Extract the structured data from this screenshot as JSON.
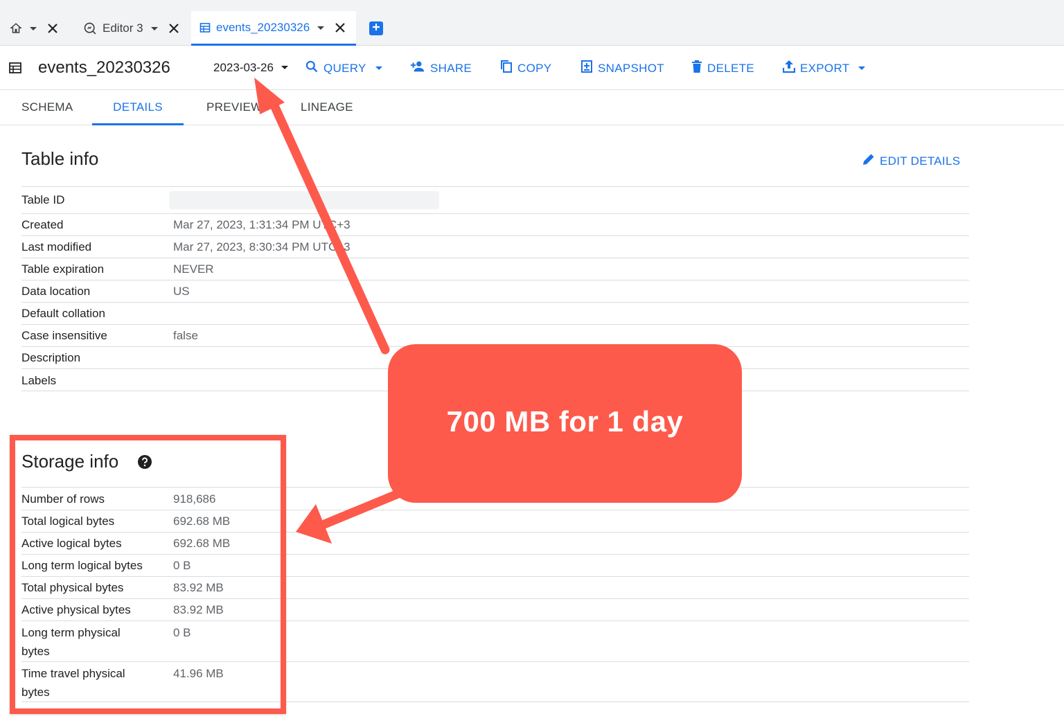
{
  "tabs": {
    "editor_label": "Editor 3",
    "active_label": "events_20230326"
  },
  "toolbar": {
    "title": "events_20230326",
    "date": "2023-03-26",
    "query": "QUERY",
    "share": "SHARE",
    "copy": "COPY",
    "snapshot": "SNAPSHOT",
    "delete": "DELETE",
    "export": "EXPORT"
  },
  "subtabs": {
    "schema": "SCHEMA",
    "details": "DETAILS",
    "preview": "PREVIEW",
    "lineage": "LINEAGE"
  },
  "table_info": {
    "title": "Table info",
    "edit_label": "EDIT DETAILS",
    "rows": [
      {
        "label": "Table ID",
        "value": ""
      },
      {
        "label": "Created",
        "value": "Mar 27, 2023, 1:31:34 PM UTC+3"
      },
      {
        "label": "Last modified",
        "value": "Mar 27, 2023, 8:30:34 PM UTC+3"
      },
      {
        "label": "Table expiration",
        "value": "NEVER"
      },
      {
        "label": "Data location",
        "value": "US"
      },
      {
        "label": "Default collation",
        "value": ""
      },
      {
        "label": "Case insensitive",
        "value": "false"
      },
      {
        "label": "Description",
        "value": ""
      },
      {
        "label": "Labels",
        "value": ""
      }
    ]
  },
  "storage_info": {
    "title": "Storage info",
    "rows": [
      {
        "label": "Number of rows",
        "value": "918,686"
      },
      {
        "label": "Total logical bytes",
        "value": "692.68 MB"
      },
      {
        "label": "Active logical bytes",
        "value": "692.68 MB"
      },
      {
        "label": "Long term logical bytes",
        "value": "0 B"
      },
      {
        "label": "Total physical bytes",
        "value": "83.92 MB"
      },
      {
        "label": "Active physical bytes",
        "value": "83.92 MB"
      },
      {
        "label": "Long term physical bytes",
        "value": "0 B"
      },
      {
        "label": "Time travel physical bytes",
        "value": "41.96 MB"
      }
    ]
  },
  "annotation": {
    "callout": "700 MB for 1 day",
    "color": "#fd5a4c"
  },
  "colors": {
    "accent": "#1a73e8"
  }
}
